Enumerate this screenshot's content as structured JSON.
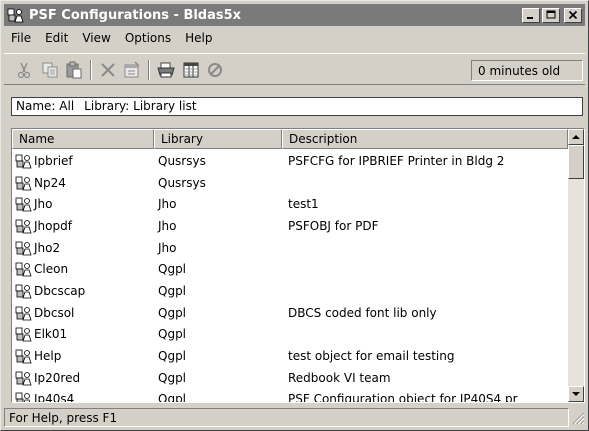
{
  "window": {
    "title": "PSF Configurations - Bldas5x",
    "minimize_glyph": "_",
    "maximize_glyph": "□",
    "close_glyph": "×"
  },
  "menu": {
    "items": [
      {
        "label": "File"
      },
      {
        "label": "Edit"
      },
      {
        "label": "View"
      },
      {
        "label": "Options"
      },
      {
        "label": "Help"
      }
    ]
  },
  "toolbar": {
    "icons": [
      "cut-icon",
      "copy-icon",
      "paste-icon",
      "delete-icon",
      "properties-icon",
      "print-icon",
      "columns-icon",
      "stop-icon"
    ],
    "age_text": "0 minutes old"
  },
  "filter": {
    "name_label": "Name:",
    "name_value": "All",
    "library_label": "Library:",
    "library_value": "Library list"
  },
  "list": {
    "columns": [
      {
        "label": "Name"
      },
      {
        "label": "Library"
      },
      {
        "label": "Description"
      }
    ],
    "rows": [
      {
        "name": "Ipbrief",
        "library": "Qusrsys",
        "description": "PSFCFG for IPBRIEF Printer in Bldg 2"
      },
      {
        "name": "Np24",
        "library": "Qusrsys",
        "description": ""
      },
      {
        "name": "Jho",
        "library": "Jho",
        "description": "test1"
      },
      {
        "name": "Jhopdf",
        "library": "Jho",
        "description": "PSFOBJ for PDF"
      },
      {
        "name": "Jho2",
        "library": "Jho",
        "description": ""
      },
      {
        "name": "Cleon",
        "library": "Qgpl",
        "description": ""
      },
      {
        "name": "Dbcscap",
        "library": "Qgpl",
        "description": ""
      },
      {
        "name": "Dbcsol",
        "library": "Qgpl",
        "description": "DBCS coded font lib only"
      },
      {
        "name": "Elk01",
        "library": "Qgpl",
        "description": ""
      },
      {
        "name": "Help",
        "library": "Qgpl",
        "description": "test object for email testing"
      },
      {
        "name": "Ip20red",
        "library": "Qgpl",
        "description": "Redbook VI team"
      },
      {
        "name": "Ip40s4",
        "library": "Qgpl",
        "description": "PSF Configuration object for IP40S4 pr"
      }
    ]
  },
  "status": {
    "text": "For Help, press F1"
  },
  "colors": {
    "titlebar": "#7a7a7a",
    "face": "#d4d0c8",
    "window_bg": "#ffffff"
  }
}
